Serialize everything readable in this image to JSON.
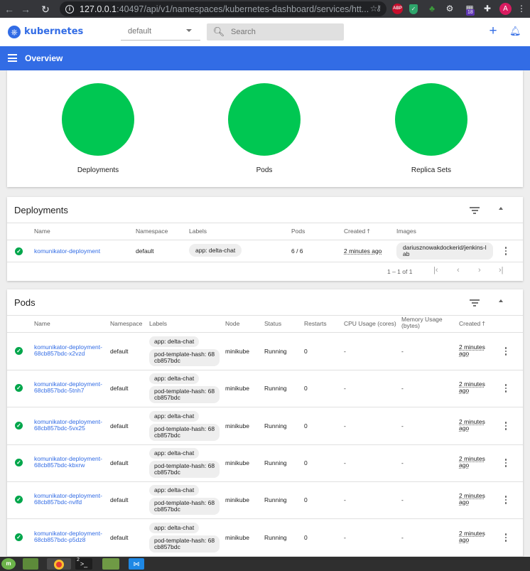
{
  "browser": {
    "url_host": "127.0.0.1",
    "url_rest": ":40497/api/v1/namespaces/kubernetes-dashboard/services/htt...",
    "ext_badge": "18",
    "avatar_letter": "A",
    "icons": [
      "back-arrow-icon",
      "forward-arrow-icon",
      "reload-icon",
      "info-icon",
      "key-icon",
      "star-icon",
      "adblock-icon",
      "shield-icon",
      "tree-icon",
      "gear-icon",
      "puzzle-icon",
      "menu-icon"
    ]
  },
  "header": {
    "brand": "kubernetes",
    "namespace": "default",
    "search_placeholder": "Search"
  },
  "toolbar": {
    "title": "Overview"
  },
  "summary": {
    "items": [
      {
        "label": "Deployments"
      },
      {
        "label": "Pods"
      },
      {
        "label": "Replica Sets"
      }
    ],
    "circle_color": "#00c752"
  },
  "deployments": {
    "title": "Deployments",
    "columns": {
      "name": "Name",
      "namespace": "Namespace",
      "labels": "Labels",
      "pods": "Pods",
      "created": "Created",
      "images": "Images"
    },
    "sort_arrow": "🡑",
    "rows": [
      {
        "name": "komunikator-deployment",
        "namespace": "default",
        "label": "app: delta-chat",
        "pods": "6 / 6",
        "created": "2 minutes ago",
        "image_line1": "dariusznowakdockerid/jenkins-l",
        "image_line2": "ab"
      }
    ],
    "pagination": {
      "range": "1 – 1 of 1",
      "first": "|‹",
      "prev": "‹",
      "next": "›",
      "last": "›|"
    }
  },
  "pods": {
    "title": "Pods",
    "columns": {
      "name": "Name",
      "namespace": "Namespace",
      "labels": "Labels",
      "node": "Node",
      "status": "Status",
      "restarts": "Restarts",
      "cpu": "CPU Usage (cores)",
      "memory_l1": "Memory Usage",
      "memory_l2": "(bytes)",
      "created": "Created"
    },
    "rows": [
      {
        "name_l1": "komunikator-deployment-",
        "name_l2": "68cb857bdc-x2vzd",
        "namespace": "default",
        "label1": "app: delta-chat",
        "label2_l1": "pod-template-hash: 68",
        "label2_l2": "cb857bdc",
        "node": "minikube",
        "status": "Running",
        "restarts": "0",
        "cpu": "-",
        "memory": "-",
        "created_l1": "2 minutes",
        "created_l2": "ago"
      },
      {
        "name_l1": "komunikator-deployment-",
        "name_l2": "68cb857bdc-5tnh7",
        "namespace": "default",
        "label1": "app: delta-chat",
        "label2_l1": "pod-template-hash: 68",
        "label2_l2": "cb857bdc",
        "node": "minikube",
        "status": "Running",
        "restarts": "0",
        "cpu": "-",
        "memory": "-",
        "created_l1": "2 minutes",
        "created_l2": "ago"
      },
      {
        "name_l1": "komunikator-deployment-",
        "name_l2": "68cb857bdc-5vx25",
        "namespace": "default",
        "label1": "app: delta-chat",
        "label2_l1": "pod-template-hash: 68",
        "label2_l2": "cb857bdc",
        "node": "minikube",
        "status": "Running",
        "restarts": "0",
        "cpu": "-",
        "memory": "-",
        "created_l1": "2 minutes",
        "created_l2": "ago"
      },
      {
        "name_l1": "komunikator-deployment-",
        "name_l2": "68cb857bdc-kbxrw",
        "namespace": "default",
        "label1": "app: delta-chat",
        "label2_l1": "pod-template-hash: 68",
        "label2_l2": "cb857bdc",
        "node": "minikube",
        "status": "Running",
        "restarts": "0",
        "cpu": "-",
        "memory": "-",
        "created_l1": "2 minutes",
        "created_l2": "ago"
      },
      {
        "name_l1": "komunikator-deployment-",
        "name_l2": "68cb857bdc-nvlfd",
        "namespace": "default",
        "label1": "app: delta-chat",
        "label2_l1": "pod-template-hash: 68",
        "label2_l2": "cb857bdc",
        "node": "minikube",
        "status": "Running",
        "restarts": "0",
        "cpu": "-",
        "memory": "-",
        "created_l1": "2 minutes",
        "created_l2": "ago"
      },
      {
        "name_l1": "komunikator-deployment-",
        "name_l2": "68cb857bdc-p5dz8",
        "namespace": "default",
        "label1": "app: delta-chat",
        "label2_l1": "pod-template-hash: 68",
        "label2_l2": "cb857bdc",
        "node": "minikube",
        "status": "Running",
        "restarts": "0",
        "cpu": "-",
        "memory": "-",
        "created_l1": "2 minutes",
        "created_l2": "ago"
      }
    ]
  },
  "taskbar": {
    "term_badge": "2",
    "term_prompt": ">_",
    "icons": [
      "mint-menu-icon",
      "desktop-icon",
      "chrome-icon",
      "terminal-icon",
      "files-icon",
      "vscode-icon"
    ]
  },
  "colors": {
    "primary": "#326ce5",
    "success": "#00a64b"
  }
}
